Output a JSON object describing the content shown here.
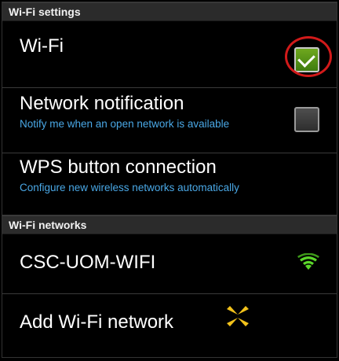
{
  "sections": {
    "settings_header": "Wi-Fi settings",
    "networks_header": "Wi-Fi networks"
  },
  "wifi": {
    "title": "Wi-Fi",
    "checked": true
  },
  "network_notification": {
    "title": "Network notification",
    "subtitle": "Notify me when an open network is available",
    "checked": false
  },
  "wps": {
    "title": "WPS button connection",
    "subtitle": "Configure new wireless networks automatically"
  },
  "networks": [
    {
      "ssid": "CSC-UOM-WIFI",
      "icon": "wifi-signal-icon",
      "signal_color": "#5bd62a"
    }
  ],
  "add_network": {
    "label": "Add Wi-Fi network",
    "icon": "add-network-icon",
    "icon_color": "#f2c21b"
  },
  "colors": {
    "subtitle": "#4aa8e6",
    "checkbox_checked": "#4f9417",
    "highlight": "#d11a1a"
  }
}
